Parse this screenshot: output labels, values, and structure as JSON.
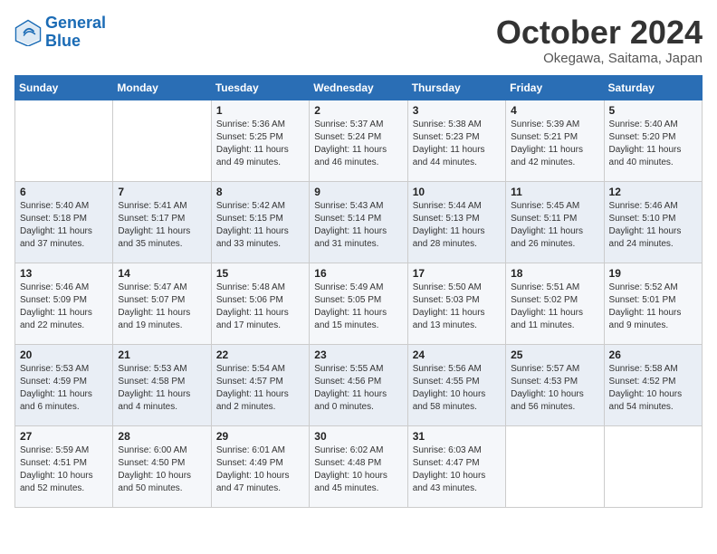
{
  "header": {
    "logo_line1": "General",
    "logo_line2": "Blue",
    "month": "October 2024",
    "location": "Okegawa, Saitama, Japan"
  },
  "weekdays": [
    "Sunday",
    "Monday",
    "Tuesday",
    "Wednesday",
    "Thursday",
    "Friday",
    "Saturday"
  ],
  "weeks": [
    [
      {
        "day": "",
        "sunrise": "",
        "sunset": "",
        "daylight": ""
      },
      {
        "day": "",
        "sunrise": "",
        "sunset": "",
        "daylight": ""
      },
      {
        "day": "1",
        "sunrise": "Sunrise: 5:36 AM",
        "sunset": "Sunset: 5:25 PM",
        "daylight": "Daylight: 11 hours and 49 minutes."
      },
      {
        "day": "2",
        "sunrise": "Sunrise: 5:37 AM",
        "sunset": "Sunset: 5:24 PM",
        "daylight": "Daylight: 11 hours and 46 minutes."
      },
      {
        "day": "3",
        "sunrise": "Sunrise: 5:38 AM",
        "sunset": "Sunset: 5:23 PM",
        "daylight": "Daylight: 11 hours and 44 minutes."
      },
      {
        "day": "4",
        "sunrise": "Sunrise: 5:39 AM",
        "sunset": "Sunset: 5:21 PM",
        "daylight": "Daylight: 11 hours and 42 minutes."
      },
      {
        "day": "5",
        "sunrise": "Sunrise: 5:40 AM",
        "sunset": "Sunset: 5:20 PM",
        "daylight": "Daylight: 11 hours and 40 minutes."
      }
    ],
    [
      {
        "day": "6",
        "sunrise": "Sunrise: 5:40 AM",
        "sunset": "Sunset: 5:18 PM",
        "daylight": "Daylight: 11 hours and 37 minutes."
      },
      {
        "day": "7",
        "sunrise": "Sunrise: 5:41 AM",
        "sunset": "Sunset: 5:17 PM",
        "daylight": "Daylight: 11 hours and 35 minutes."
      },
      {
        "day": "8",
        "sunrise": "Sunrise: 5:42 AM",
        "sunset": "Sunset: 5:15 PM",
        "daylight": "Daylight: 11 hours and 33 minutes."
      },
      {
        "day": "9",
        "sunrise": "Sunrise: 5:43 AM",
        "sunset": "Sunset: 5:14 PM",
        "daylight": "Daylight: 11 hours and 31 minutes."
      },
      {
        "day": "10",
        "sunrise": "Sunrise: 5:44 AM",
        "sunset": "Sunset: 5:13 PM",
        "daylight": "Daylight: 11 hours and 28 minutes."
      },
      {
        "day": "11",
        "sunrise": "Sunrise: 5:45 AM",
        "sunset": "Sunset: 5:11 PM",
        "daylight": "Daylight: 11 hours and 26 minutes."
      },
      {
        "day": "12",
        "sunrise": "Sunrise: 5:46 AM",
        "sunset": "Sunset: 5:10 PM",
        "daylight": "Daylight: 11 hours and 24 minutes."
      }
    ],
    [
      {
        "day": "13",
        "sunrise": "Sunrise: 5:46 AM",
        "sunset": "Sunset: 5:09 PM",
        "daylight": "Daylight: 11 hours and 22 minutes."
      },
      {
        "day": "14",
        "sunrise": "Sunrise: 5:47 AM",
        "sunset": "Sunset: 5:07 PM",
        "daylight": "Daylight: 11 hours and 19 minutes."
      },
      {
        "day": "15",
        "sunrise": "Sunrise: 5:48 AM",
        "sunset": "Sunset: 5:06 PM",
        "daylight": "Daylight: 11 hours and 17 minutes."
      },
      {
        "day": "16",
        "sunrise": "Sunrise: 5:49 AM",
        "sunset": "Sunset: 5:05 PM",
        "daylight": "Daylight: 11 hours and 15 minutes."
      },
      {
        "day": "17",
        "sunrise": "Sunrise: 5:50 AM",
        "sunset": "Sunset: 5:03 PM",
        "daylight": "Daylight: 11 hours and 13 minutes."
      },
      {
        "day": "18",
        "sunrise": "Sunrise: 5:51 AM",
        "sunset": "Sunset: 5:02 PM",
        "daylight": "Daylight: 11 hours and 11 minutes."
      },
      {
        "day": "19",
        "sunrise": "Sunrise: 5:52 AM",
        "sunset": "Sunset: 5:01 PM",
        "daylight": "Daylight: 11 hours and 9 minutes."
      }
    ],
    [
      {
        "day": "20",
        "sunrise": "Sunrise: 5:53 AM",
        "sunset": "Sunset: 4:59 PM",
        "daylight": "Daylight: 11 hours and 6 minutes."
      },
      {
        "day": "21",
        "sunrise": "Sunrise: 5:53 AM",
        "sunset": "Sunset: 4:58 PM",
        "daylight": "Daylight: 11 hours and 4 minutes."
      },
      {
        "day": "22",
        "sunrise": "Sunrise: 5:54 AM",
        "sunset": "Sunset: 4:57 PM",
        "daylight": "Daylight: 11 hours and 2 minutes."
      },
      {
        "day": "23",
        "sunrise": "Sunrise: 5:55 AM",
        "sunset": "Sunset: 4:56 PM",
        "daylight": "Daylight: 11 hours and 0 minutes."
      },
      {
        "day": "24",
        "sunrise": "Sunrise: 5:56 AM",
        "sunset": "Sunset: 4:55 PM",
        "daylight": "Daylight: 10 hours and 58 minutes."
      },
      {
        "day": "25",
        "sunrise": "Sunrise: 5:57 AM",
        "sunset": "Sunset: 4:53 PM",
        "daylight": "Daylight: 10 hours and 56 minutes."
      },
      {
        "day": "26",
        "sunrise": "Sunrise: 5:58 AM",
        "sunset": "Sunset: 4:52 PM",
        "daylight": "Daylight: 10 hours and 54 minutes."
      }
    ],
    [
      {
        "day": "27",
        "sunrise": "Sunrise: 5:59 AM",
        "sunset": "Sunset: 4:51 PM",
        "daylight": "Daylight: 10 hours and 52 minutes."
      },
      {
        "day": "28",
        "sunrise": "Sunrise: 6:00 AM",
        "sunset": "Sunset: 4:50 PM",
        "daylight": "Daylight: 10 hours and 50 minutes."
      },
      {
        "day": "29",
        "sunrise": "Sunrise: 6:01 AM",
        "sunset": "Sunset: 4:49 PM",
        "daylight": "Daylight: 10 hours and 47 minutes."
      },
      {
        "day": "30",
        "sunrise": "Sunrise: 6:02 AM",
        "sunset": "Sunset: 4:48 PM",
        "daylight": "Daylight: 10 hours and 45 minutes."
      },
      {
        "day": "31",
        "sunrise": "Sunrise: 6:03 AM",
        "sunset": "Sunset: 4:47 PM",
        "daylight": "Daylight: 10 hours and 43 minutes."
      },
      {
        "day": "",
        "sunrise": "",
        "sunset": "",
        "daylight": ""
      },
      {
        "day": "",
        "sunrise": "",
        "sunset": "",
        "daylight": ""
      }
    ]
  ]
}
